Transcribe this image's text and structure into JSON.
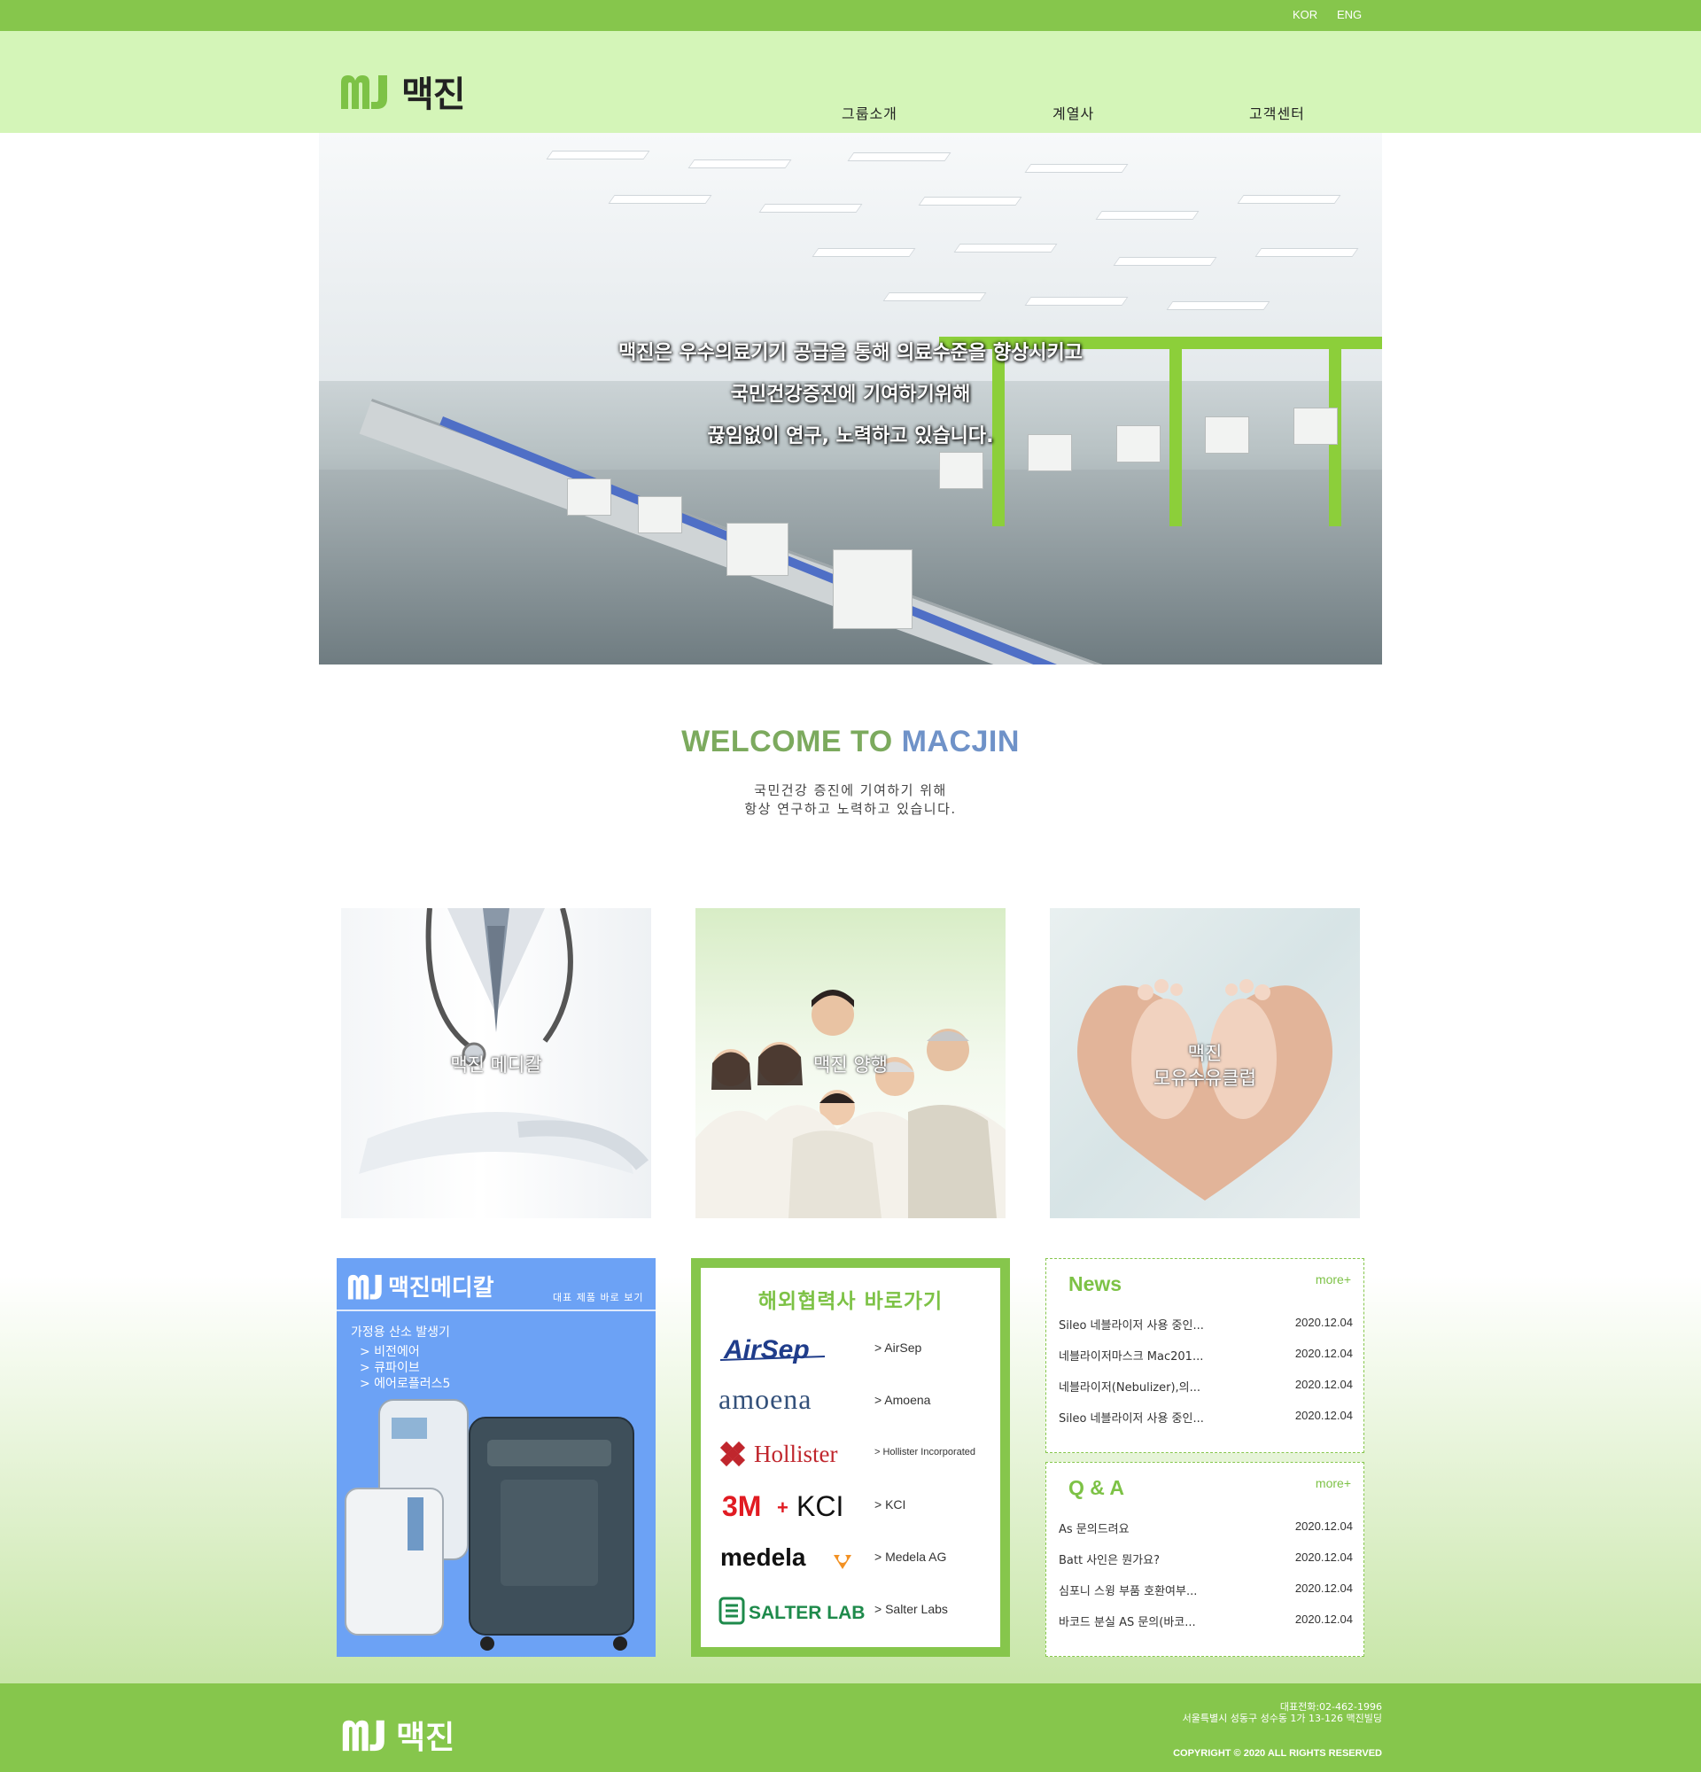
{
  "topbar": {
    "lang_kor": "KOR",
    "lang_eng": "ENG"
  },
  "header": {
    "logo_mark": "MJ",
    "logo_text": "맥진",
    "nav": [
      "그룹소개",
      "계열사",
      "고객센터"
    ]
  },
  "hero": {
    "lines": [
      "맥진은 우수의료기기 공급을 통해 의료수준을 향상시키고",
      "국민건강증진에 기여하기위해",
      "끊임없이 연구, 노력하고 있습니다."
    ]
  },
  "welcome": {
    "title_a": "WELCOME TO ",
    "title_b": "MACJIN",
    "sub": [
      "국민건강 증진에 기여하기 위해",
      "항상 연구하고 노력하고 있습니다."
    ]
  },
  "cards": [
    {
      "label": [
        "맥진 메디칼"
      ]
    },
    {
      "label": [
        "맥진 양행"
      ]
    },
    {
      "label": [
        "맥진",
        "모유수유클럽"
      ]
    }
  ],
  "medical": {
    "title": "맥진메디칼",
    "subtitle": "대표 제품 바로 보기",
    "category": "가정용 산소 발생기",
    "items": [
      "> 비전에어",
      "> 큐파이브",
      "> 에어로플러스5"
    ]
  },
  "partners": {
    "title": "해외협력사 바로가기",
    "items": [
      {
        "logo": "AirSep",
        "name": "> AirSep"
      },
      {
        "logo": "amoena",
        "name": "> Amoena"
      },
      {
        "logo": "Hollister",
        "name": "> Hollister Incorporated"
      },
      {
        "logo": "3M KCI",
        "name": "> KCI"
      },
      {
        "logo": "medela",
        "name": "> Medela AG"
      },
      {
        "logo": "SALTER LABS",
        "name": "> Salter Labs"
      }
    ]
  },
  "news": {
    "title": "News",
    "more": "more+",
    "rows": [
      {
        "title": "Sileo 네블라이저 사용 중인...",
        "date": "2020.12.04"
      },
      {
        "title": "네블라이저마스크 Mac201...",
        "date": "2020.12.04"
      },
      {
        "title": "네블라이저(Nebulizer),의...",
        "date": "2020.12.04"
      },
      {
        "title": "Sileo 네블라이저 사용 중인...",
        "date": "2020.12.04"
      }
    ]
  },
  "qa": {
    "title": "Q & A",
    "more": "more+",
    "rows": [
      {
        "title": "As 문의드려요",
        "date": "2020.12.04"
      },
      {
        "title": "Batt 사인은 뭔가요?",
        "date": "2020.12.04"
      },
      {
        "title": "심포니 스윙 부품 호환여부...",
        "date": "2020.12.04"
      },
      {
        "title": "바코드 분실 AS 문의(바코...",
        "date": "2020.12.04"
      }
    ]
  },
  "footer": {
    "logo_text": "맥진",
    "phone": "대표전화:02-462-1996",
    "address": "서울특별시 성동구 성수동 1가 13-126 맥진빌딩",
    "copyright": "COPYRIGHT © 2020 ALL RIGHTS RESERVED"
  },
  "colors": {
    "green": "#86c64c",
    "light_green": "#d4f5b8",
    "blue_panel": "#6ca2f5",
    "title_green": "#7dc246"
  }
}
